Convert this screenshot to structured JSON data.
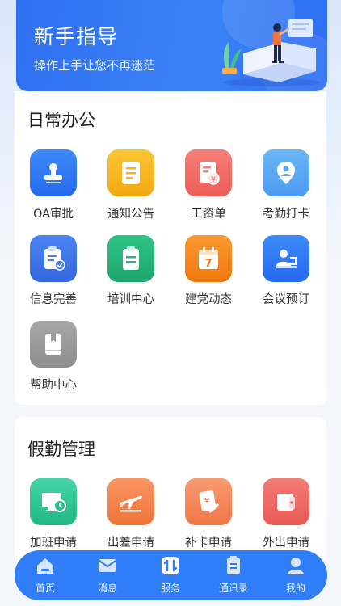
{
  "banner": {
    "title": "新手指导",
    "subtitle": "操作上手让您不再迷茫"
  },
  "daily_office": {
    "title": "日常办公",
    "items": [
      {
        "label": "OA审批",
        "icon": "stamp-icon",
        "color": "#2f7df6"
      },
      {
        "label": "通知公告",
        "icon": "document-icon",
        "color": "#f6b91d"
      },
      {
        "label": "工资单",
        "icon": "payslip-icon",
        "color": "#f0716b"
      },
      {
        "label": "考勤打卡",
        "icon": "location-person-icon",
        "color": "#58a8f5"
      },
      {
        "label": "信息完善",
        "icon": "clipboard-check-icon",
        "color": "#3d76ea"
      },
      {
        "label": "培训中心",
        "icon": "clipboard-icon",
        "color": "#26b47c"
      },
      {
        "label": "建党动态",
        "icon": "calendar-icon",
        "color": "#f7881f"
      },
      {
        "label": "会议预订",
        "icon": "person-meeting-icon",
        "color": "#2f7df6"
      },
      {
        "label": "帮助中心",
        "icon": "book-icon",
        "color": "#9b9b9b"
      }
    ]
  },
  "leave_management": {
    "title": "假勤管理",
    "items": [
      {
        "label": "加班申请",
        "icon": "monitor-clock-icon",
        "color": "#34c79a"
      },
      {
        "label": "出差申请",
        "icon": "airplane-icon",
        "color": "#f6834b"
      },
      {
        "label": "补卡申请",
        "icon": "card-edit-icon",
        "color": "#f58b5e"
      },
      {
        "label": "外出申请",
        "icon": "wallet-icon",
        "color": "#f0706a"
      }
    ]
  },
  "tabbar": {
    "items": [
      {
        "label": "首页",
        "icon": "home-icon"
      },
      {
        "label": "消息",
        "icon": "mail-icon"
      },
      {
        "label": "服务",
        "icon": "service-icon"
      },
      {
        "label": "通讯录",
        "icon": "contacts-icon"
      },
      {
        "label": "我的",
        "icon": "user-icon"
      }
    ]
  }
}
